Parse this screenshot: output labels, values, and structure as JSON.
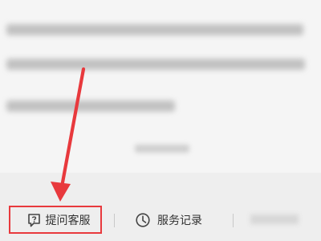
{
  "bottom_bar": {
    "help_label": "提问客服",
    "service_label": "服务记录"
  },
  "annotation": {
    "arrow_color": "#e8393d"
  }
}
